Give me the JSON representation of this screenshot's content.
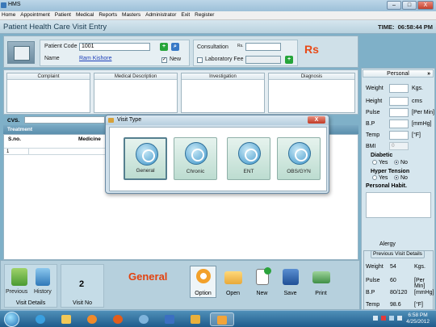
{
  "window": {
    "title": "HMS",
    "minimize": "–",
    "maximize": "□",
    "close": "X"
  },
  "menu": [
    "Home",
    "Appointment",
    "Patient",
    "Medical",
    "Reports",
    "Masters",
    "Administrator",
    "Exit",
    "Register"
  ],
  "header": {
    "title": "Patient Health Care Visit Entry",
    "time_label": "TIME:",
    "time_value": "06:58:44 PM"
  },
  "patient": {
    "code_label": "Patient Code",
    "code_value": "1001",
    "name_label": "Name",
    "name_value": "Ram Kishore",
    "new_label": "New",
    "new_checked": true
  },
  "fees": {
    "consultation_label": "Consultation",
    "rs_small": "Rs.",
    "lab_fee_label": "Laboratory Fee",
    "currency_big": "Rs"
  },
  "grid_columns": [
    "Complaint",
    "Medical Description",
    "Investigation",
    "Diagnosis"
  ],
  "cvs_label": "CVS.",
  "treatment": {
    "title": "Treatment",
    "headers": [
      "S.no.",
      "Medicine"
    ],
    "rows": [
      {
        "sno": "1"
      }
    ]
  },
  "vitals": {
    "panel_title": "Personal",
    "collapse": "»",
    "fields": [
      {
        "label": "Weight",
        "unit": "Kgs."
      },
      {
        "label": "Height",
        "unit": "cms"
      },
      {
        "label": "Pulse",
        "unit": "[Per Min]"
      },
      {
        "label": "B.P",
        "unit": "[mmHg]"
      },
      {
        "label": "Temp",
        "unit": "[°F]"
      }
    ],
    "bmi_label": "BMI",
    "bmi_value": "0",
    "diabetic_label": "Diabetic",
    "hypertension_label": "Hyper Tension",
    "yes": "Yes",
    "no": "No",
    "habit_label": "Personal Habit.",
    "allergy_label": "Alergy"
  },
  "previous_visit": {
    "title": "Previous Visit Details",
    "rows": [
      {
        "label": "Weight",
        "value": "54",
        "unit": "Kgs."
      },
      {
        "label": "Pulse",
        "value": "60",
        "unit": "[Per Min]"
      },
      {
        "label": "B.P",
        "value": "80/120",
        "unit": "[mmHg]"
      },
      {
        "label": "Temp",
        "value": "98.6",
        "unit": "[°F]"
      }
    ]
  },
  "bottom": {
    "previous_label": "Previous",
    "history_label": "History",
    "visit_details_label": "Visit Details",
    "visit_no": "2",
    "visit_no_label": "Visit No",
    "visit_type": "General",
    "toolbar": [
      "Option",
      "Open",
      "New",
      "Save",
      "Print"
    ]
  },
  "dialog": {
    "title": "Visit Type",
    "close": "X",
    "options": [
      "General",
      "Chronic",
      "ENT",
      "OBS/GYN"
    ]
  },
  "taskbar": {
    "time": "6:58 PM",
    "date": "4/25/2012"
  },
  "colors": {
    "accent_orange": "#e3420f",
    "header_blue": "#5b8fad",
    "add_green": "#26a53a"
  }
}
